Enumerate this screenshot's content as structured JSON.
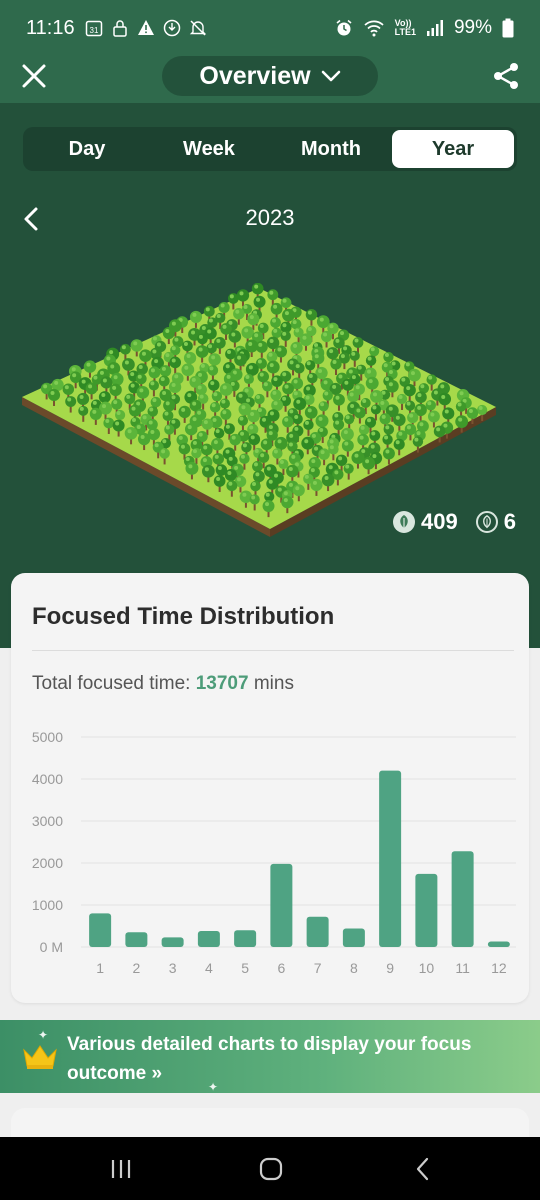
{
  "status_bar": {
    "time": "11:16",
    "left_icons": [
      "calendar-icon",
      "lock-icon",
      "warning-icon",
      "stop-icon",
      "mute-icon"
    ],
    "calendar_day": "31",
    "right_icons": [
      "alarm-icon",
      "wifi-icon",
      "signal-icon",
      "battery-icon"
    ],
    "network_label_top": "Vo))",
    "network_label_bottom": "LTE1",
    "battery": "99%"
  },
  "top_bar": {
    "title": "Overview",
    "close_icon": "close-icon",
    "share_icon": "share-icon"
  },
  "tabs": [
    {
      "label": "Day",
      "active": false
    },
    {
      "label": "Week",
      "active": false
    },
    {
      "label": "Month",
      "active": false
    },
    {
      "label": "Year",
      "active": true
    }
  ],
  "period": {
    "label": "2023"
  },
  "forest": {
    "healthy_count": "409",
    "withered_count": "6"
  },
  "distribution": {
    "title": "Focused Time Distribution",
    "total_prefix": "Total focused time: ",
    "total_value": "13707",
    "total_suffix": " mins"
  },
  "chart_data": {
    "type": "bar",
    "categories": [
      "1",
      "2",
      "3",
      "4",
      "5",
      "6",
      "7",
      "8",
      "9",
      "10",
      "11",
      "12"
    ],
    "values": [
      800,
      350,
      230,
      380,
      400,
      1980,
      720,
      440,
      4200,
      1740,
      2280,
      130
    ],
    "y_ticks": [
      "0 M",
      "1000",
      "2000",
      "3000",
      "4000",
      "5000"
    ],
    "ylim": [
      0,
      5000
    ],
    "grid": true,
    "bar_color": "#4fa383"
  },
  "banner": {
    "text": "Various detailed charts to display your focus outcome »"
  },
  "colors": {
    "header_green": "#2f6a4c",
    "hero_green": "#23513a",
    "accent": "#4d9c79"
  }
}
